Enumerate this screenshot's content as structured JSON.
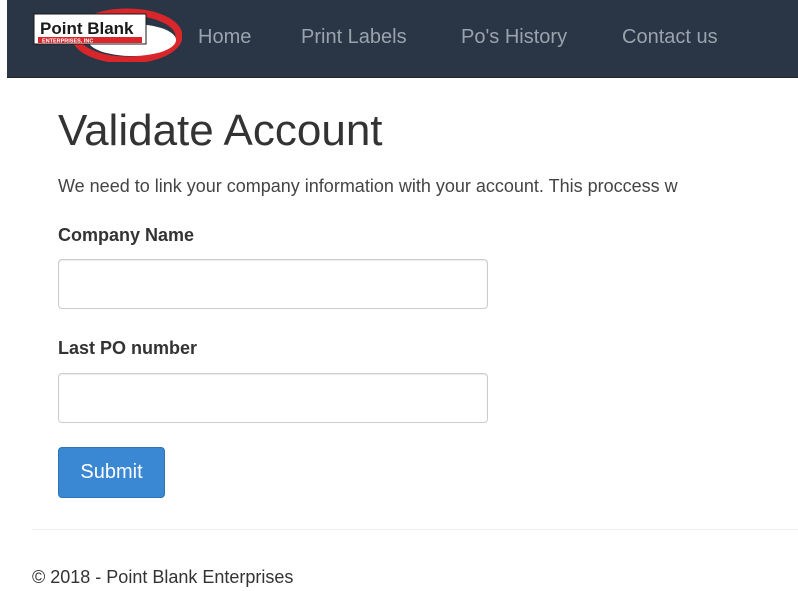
{
  "navbar": {
    "logo": {
      "line1": "Point Blank",
      "line2": "ENTERPRISES, INC",
      "colors": {
        "ring": "#d9262b",
        "text": "#1a1a1a",
        "plate": "#ffffff"
      }
    },
    "links": {
      "home": "Home",
      "print_labels": "Print Labels",
      "po_history": "Po's History",
      "contact": "Contact us"
    },
    "background": "#2a3645"
  },
  "main": {
    "title": "Validate Account",
    "intro": "We need to link your company information with your account. This proccess w",
    "form": {
      "company_name": {
        "label": "Company Name",
        "value": "",
        "placeholder": ""
      },
      "last_po": {
        "label": "Last PO number",
        "value": "",
        "placeholder": ""
      },
      "submit_label": "Submit",
      "submit_color": "#3a87d3"
    }
  },
  "footer": {
    "text": "© 2018 - Point Blank Enterprises"
  }
}
